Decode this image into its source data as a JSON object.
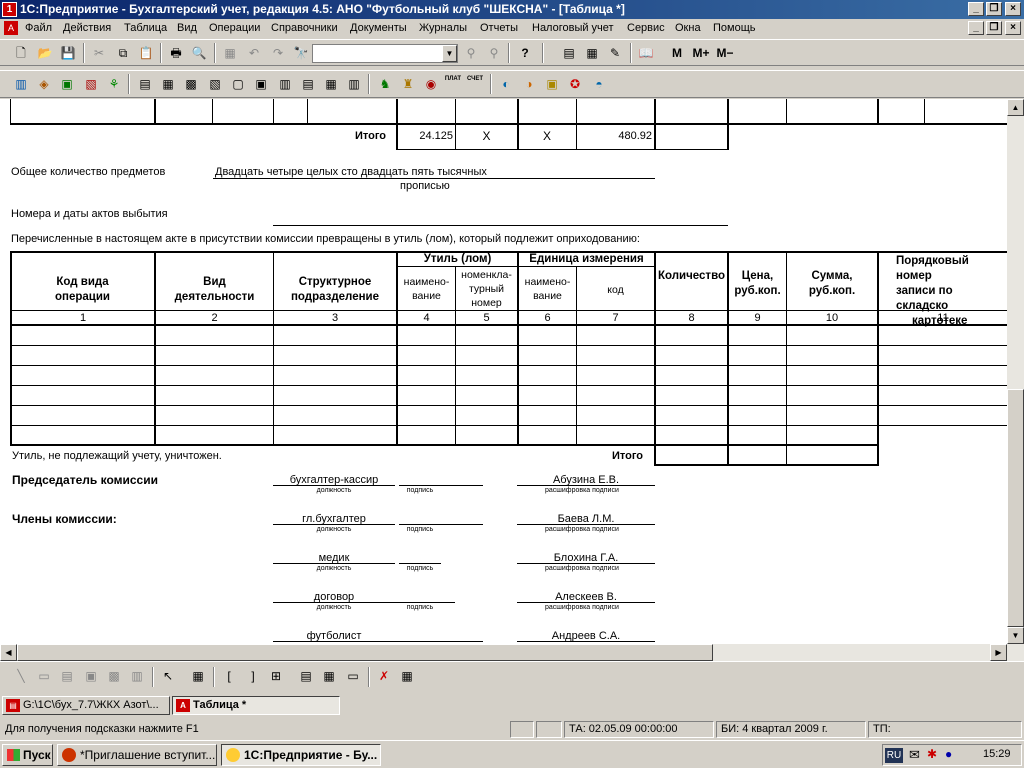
{
  "window": {
    "title": "1С:Предприятие - Бухгалтерский учет, редакция 4.5: АНО \"Футбольный клуб \"ШЕКСНА\" - [Таблица  *]"
  },
  "menu": [
    "Файл",
    "Действия",
    "Таблица",
    "Вид",
    "Операции",
    "Справочники",
    "Документы",
    "Журналы",
    "Отчеты",
    "Налоговый учет",
    "Сервис",
    "Окна",
    "Помощь"
  ],
  "toolbar": {
    "memory_buttons": [
      "M",
      "M+",
      "M−"
    ],
    "combo_value": "",
    "row2_labels": [
      "ПЛАТ",
      "СЧЕТ"
    ]
  },
  "document": {
    "totals_row": {
      "label": "Итого",
      "quantity": "24.125",
      "x1": "X",
      "x2": "X",
      "sum": "480.92"
    },
    "total_items_label": "Общее количество предметов",
    "total_items_value": "Двадцать четыре целых сто двадцать пять тысячных",
    "in_words_caption": "прописью",
    "acts_label": "Номера и даты актов выбытия",
    "converted_text": "Перечисленные в настоящем акте в присутствии комиссии превращены в утиль (лом), который подлежит оприходованию:",
    "table_headers": {
      "col1": [
        "Код вида",
        "операции"
      ],
      "col2": [
        "Вид",
        "деятельности"
      ],
      "col3": [
        "Структурное",
        "подразделение"
      ],
      "scrap_group": "Утиль (лом)",
      "col4": [
        "наимено-",
        "вание"
      ],
      "col5": [
        "номенкла-",
        "турный",
        "номер"
      ],
      "unit_group": "Единица измерения",
      "col6": [
        "наимено-",
        "вание"
      ],
      "col7": "код",
      "col8": "Количество",
      "col9": [
        "Цена,",
        "руб.коп."
      ],
      "col10": [
        "Сумма,",
        "руб.коп."
      ],
      "col11": [
        "Порядковый номер",
        "записи по складско",
        "картотеке"
      ]
    },
    "column_numbers": [
      "1",
      "2",
      "3",
      "4",
      "5",
      "6",
      "7",
      "8",
      "9",
      "10",
      "11"
    ],
    "not_counted_text": "Утиль, не подлежащий учету, уничтожен.",
    "total_label": "Итого",
    "chairman_label": "Председатель комиссии",
    "members_label": "Члены комиссии:",
    "caption_position": "должность",
    "caption_signature": "подпись",
    "caption_decode": "расшифровка подписи",
    "signatories": [
      {
        "position": "бухгалтер-кассир",
        "name": "Абузина Е.В."
      },
      {
        "position": "гл.бухгалтер",
        "name": "Баева Л.М."
      },
      {
        "position": "медик",
        "name": "Блохина Г.А."
      },
      {
        "position": "договор",
        "name": "Алескеев В."
      },
      {
        "position": "футболист",
        "name": "Андреев С.А."
      }
    ]
  },
  "window_tabs": [
    {
      "label": "G:\\1С\\бух_7.7\\ЖКХ Азот\\..."
    },
    {
      "label": "Таблица  *"
    }
  ],
  "status": {
    "hint": "Для получения подсказки нажмите F1",
    "ta": "ТА: 02.05.09  00:00:00",
    "bi": "БИ: 4 квартал 2009 г.",
    "tp": "ТП:"
  },
  "taskbar": {
    "start": "Пуск",
    "tasks": [
      "*Приглашение вступит...",
      "1С:Предприятие - Бу..."
    ],
    "lang": "RU",
    "clock": "15:29"
  }
}
